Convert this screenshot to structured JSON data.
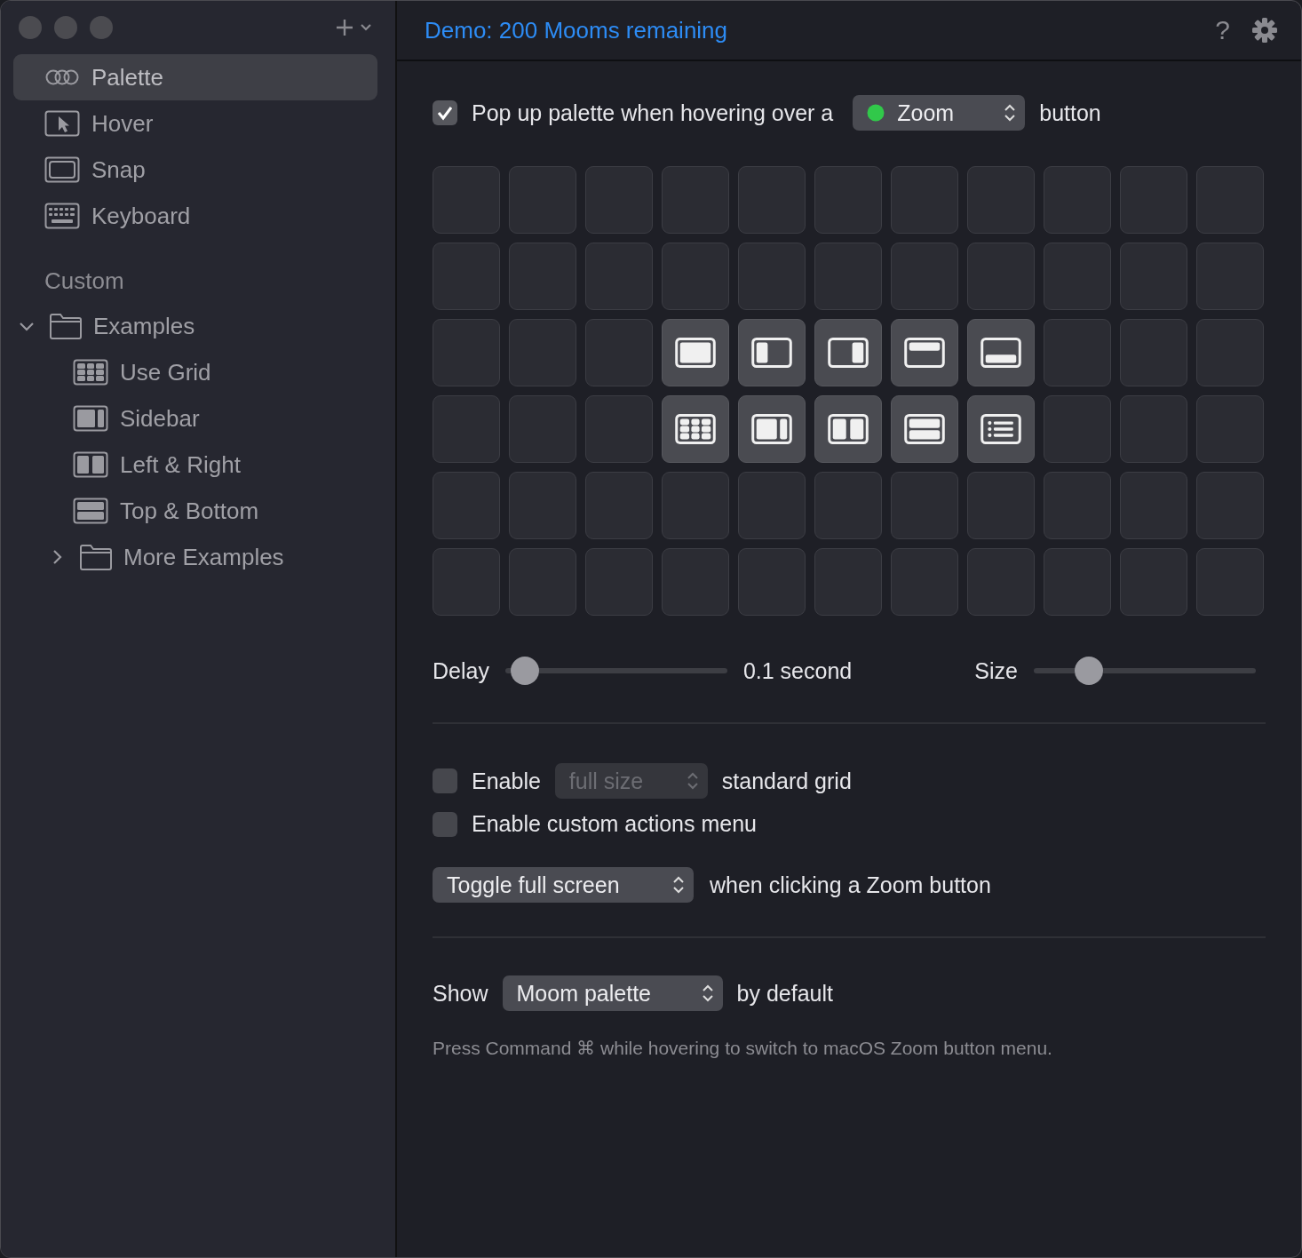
{
  "sidebar": {
    "items": [
      {
        "label": "Palette",
        "kind": "palette",
        "selected": true
      },
      {
        "label": "Hover",
        "kind": "hover",
        "selected": false
      },
      {
        "label": "Snap",
        "kind": "snap",
        "selected": false
      },
      {
        "label": "Keyboard",
        "kind": "keyboard",
        "selected": false
      }
    ],
    "section_title": "Custom",
    "tree": [
      {
        "label": "Examples",
        "expanded": true,
        "selected": false,
        "children": [
          {
            "label": "Use Grid",
            "kind": "grid",
            "selected": false
          },
          {
            "label": "Sidebar",
            "kind": "sidebar",
            "selected": false
          },
          {
            "label": "Left & Right",
            "kind": "split",
            "selected": false
          },
          {
            "label": "Top & Bottom",
            "kind": "stacked",
            "selected": false
          }
        ]
      },
      {
        "label": "More Examples",
        "expanded": false,
        "selected": false
      }
    ]
  },
  "header": {
    "title": "Demo: 200 Mooms remaining",
    "help": "?"
  },
  "popup_option": {
    "checked": true,
    "label": "Pop up palette when hovering over a",
    "popup": "Zoom",
    "suffix": "button"
  },
  "palette_grid": {
    "rows": [
      {
        "cells": [
          {
            "kind": "empty"
          },
          {
            "kind": "empty"
          },
          {
            "kind": "empty"
          },
          {
            "kind": "empty"
          },
          {
            "kind": "empty"
          },
          {
            "kind": "empty"
          },
          {
            "kind": "empty"
          },
          {
            "kind": "empty"
          },
          {
            "kind": "empty"
          },
          {
            "kind": "empty"
          },
          {
            "kind": "empty"
          }
        ]
      },
      {
        "cells": [
          {
            "kind": "empty"
          },
          {
            "kind": "empty"
          },
          {
            "kind": "empty"
          },
          {
            "kind": "empty"
          },
          {
            "kind": "empty"
          },
          {
            "kind": "empty"
          },
          {
            "kind": "empty"
          },
          {
            "kind": "empty"
          },
          {
            "kind": "empty"
          },
          {
            "kind": "empty"
          },
          {
            "kind": "empty"
          }
        ]
      },
      {
        "cells": [
          {
            "kind": "empty"
          },
          {
            "kind": "empty"
          },
          {
            "kind": "empty"
          },
          {
            "kind": "full"
          },
          {
            "kind": "left"
          },
          {
            "kind": "right"
          },
          {
            "kind": "top"
          },
          {
            "kind": "bottom"
          },
          {
            "kind": "empty"
          },
          {
            "kind": "empty"
          },
          {
            "kind": "empty"
          }
        ]
      },
      {
        "cells": [
          {
            "kind": "empty"
          },
          {
            "kind": "empty"
          },
          {
            "kind": "empty"
          },
          {
            "kind": "grid"
          },
          {
            "kind": "sidebar"
          },
          {
            "kind": "split"
          },
          {
            "kind": "stacked"
          },
          {
            "kind": "list"
          },
          {
            "kind": "empty"
          },
          {
            "kind": "empty"
          },
          {
            "kind": "empty"
          }
        ]
      },
      {
        "cells": [
          {
            "kind": "empty"
          },
          {
            "kind": "empty"
          },
          {
            "kind": "empty"
          },
          {
            "kind": "empty"
          },
          {
            "kind": "empty"
          },
          {
            "kind": "empty"
          },
          {
            "kind": "empty"
          },
          {
            "kind": "empty"
          },
          {
            "kind": "empty"
          },
          {
            "kind": "empty"
          },
          {
            "kind": "empty"
          }
        ]
      },
      {
        "cells": [
          {
            "kind": "empty"
          },
          {
            "kind": "empty"
          },
          {
            "kind": "empty"
          },
          {
            "kind": "empty"
          },
          {
            "kind": "empty"
          },
          {
            "kind": "empty"
          },
          {
            "kind": "empty"
          },
          {
            "kind": "empty"
          },
          {
            "kind": "empty"
          },
          {
            "kind": "empty"
          },
          {
            "kind": "empty"
          }
        ]
      }
    ]
  },
  "delay": {
    "label": "Delay",
    "level": 0.09,
    "reading": "0.1 second"
  },
  "size": {
    "label": "Size",
    "level": 0.25
  },
  "standard_grid": {
    "checked": false,
    "label": "Enable",
    "popup": "full size",
    "popup_disabled": true,
    "suffix": "standard grid"
  },
  "custom_actions": {
    "checked": false,
    "label": "Enable custom actions menu"
  },
  "click_action": {
    "popup": "Toggle full screen",
    "suffix": "when clicking a Zoom button"
  },
  "default_view": {
    "prefix": "Show",
    "popup": "Moom palette",
    "suffix": "by default"
  },
  "hint": "Press Command ⌘ while hovering to switch to macOS Zoom button menu."
}
